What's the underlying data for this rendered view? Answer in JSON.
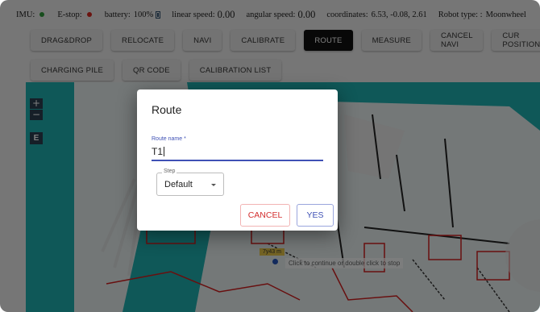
{
  "status": {
    "imu_label": "IMU:",
    "estop_label": "E-stop:",
    "battery_label": "battery:",
    "battery_value": "100%",
    "linear_label": "linear speed:",
    "linear_value": "0.00",
    "angular_label": "angular speed:",
    "angular_value": "0.00",
    "coords_label": "coordinates:",
    "coords_value": "6.53, -0.08, 2.61",
    "robot_label": "Robot type: :",
    "robot_value": "Moonwheel",
    "imu_color": "#2e9b3a",
    "estop_color": "#d7261e"
  },
  "toolbar": {
    "row1": [
      "DRAG&DROP",
      "RELOCATE",
      "NAVI",
      "CALIBRATE",
      "ROUTE",
      "MEASURE",
      "CANCEL NAVI",
      "CUR POSITION"
    ],
    "row2": [
      "CHARGING PILE",
      "QR CODE",
      "CALIBRATION LIST"
    ],
    "active": "ROUTE"
  },
  "map": {
    "zoom_in": "+",
    "zoom_out": "−",
    "e_button": "E",
    "marker_label": "7y43 m",
    "hint": "Click to continue or double click to stop",
    "bg_color": "#1fb1b1"
  },
  "dialog": {
    "title": "Route",
    "route_name_label": "Route name *",
    "route_name_value": "T1",
    "step_label": "Step",
    "step_value": "Default",
    "cancel_label": "CANCEL",
    "yes_label": "YES"
  }
}
